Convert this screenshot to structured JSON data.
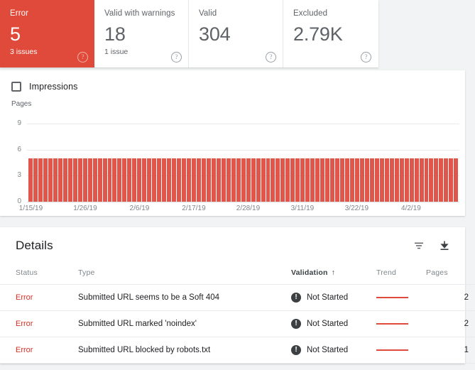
{
  "summary_cards": [
    {
      "label": "Error",
      "value": "5",
      "sub": "3 issues",
      "help": "?",
      "state": "error"
    },
    {
      "label": "Valid with warnings",
      "value": "18",
      "sub": "1 issue",
      "help": "?",
      "state": "warning"
    },
    {
      "label": "Valid",
      "value": "304",
      "sub": "",
      "help": "?",
      "state": "valid"
    },
    {
      "label": "Excluded",
      "value": "2.79K",
      "sub": "",
      "help": "?",
      "state": "excluded"
    }
  ],
  "chart_panel": {
    "legend": {
      "label": "Impressions",
      "checked": false,
      "checkbox_icon": "checkbox-unchecked-icon"
    }
  },
  "chart_data": {
    "type": "bar",
    "title": "",
    "ylabel": "Pages",
    "xlabel": "",
    "ylim": [
      0,
      9
    ],
    "yticks": [
      0,
      3,
      6,
      9
    ],
    "grid": true,
    "legend_position": "top-left",
    "bar_color": "#e0564a",
    "categories": [
      "1/15/19",
      "1/16/19",
      "1/17/19",
      "1/18/19",
      "1/19/19",
      "1/20/19",
      "1/21/19",
      "1/22/19",
      "1/23/19",
      "1/24/19",
      "1/25/19",
      "1/26/19",
      "1/27/19",
      "1/28/19",
      "1/29/19",
      "1/30/19",
      "1/31/19",
      "2/1/19",
      "2/2/19",
      "2/3/19",
      "2/4/19",
      "2/5/19",
      "2/6/19",
      "2/7/19",
      "2/8/19",
      "2/9/19",
      "2/10/19",
      "2/11/19",
      "2/12/19",
      "2/13/19",
      "2/14/19",
      "2/15/19",
      "2/16/19",
      "2/17/19",
      "2/18/19",
      "2/19/19",
      "2/20/19",
      "2/21/19",
      "2/22/19",
      "2/23/19",
      "2/24/19",
      "2/25/19",
      "2/26/19",
      "2/27/19",
      "2/28/19",
      "3/1/19",
      "3/2/19",
      "3/3/19",
      "3/4/19",
      "3/5/19",
      "3/6/19",
      "3/7/19",
      "3/8/19",
      "3/9/19",
      "3/10/19",
      "3/11/19",
      "3/12/19",
      "3/13/19",
      "3/14/19",
      "3/15/19",
      "3/16/19",
      "3/17/19",
      "3/18/19",
      "3/19/19",
      "3/20/19",
      "3/21/19",
      "3/22/19",
      "3/23/19",
      "3/24/19",
      "3/25/19",
      "3/26/19",
      "3/27/19",
      "3/28/19",
      "3/29/19",
      "3/30/19",
      "3/31/19",
      "4/1/19",
      "4/2/19",
      "4/3/19",
      "4/4/19",
      "4/5/19",
      "4/6/19",
      "4/7/19",
      "4/8/19",
      "4/9/19",
      "4/10/19",
      "4/11/19"
    ],
    "values": [
      5,
      5,
      5,
      5,
      5,
      5,
      5,
      5,
      5,
      5,
      5,
      5,
      5,
      5,
      5,
      5,
      5,
      5,
      5,
      5,
      5,
      5,
      5,
      5,
      5,
      5,
      5,
      5,
      5,
      5,
      5,
      5,
      5,
      5,
      5,
      5,
      5,
      5,
      5,
      5,
      5,
      5,
      5,
      5,
      5,
      5,
      5,
      5,
      5,
      5,
      5,
      5,
      5,
      5,
      5,
      5,
      5,
      5,
      5,
      5,
      5,
      5,
      5,
      5,
      5,
      5,
      5,
      5,
      5,
      5,
      5,
      5,
      5,
      5,
      5,
      5,
      5,
      5,
      5,
      5,
      5,
      5,
      5,
      5,
      5,
      5,
      5
    ],
    "xtick_labels": [
      "1/15/19",
      "1/26/19",
      "2/6/19",
      "2/17/19",
      "2/28/19",
      "3/11/19",
      "3/22/19",
      "4/2/19"
    ],
    "series": [
      {
        "name": "Pages",
        "values": [
          5
        ]
      }
    ]
  },
  "details": {
    "title": "Details",
    "filter_icon": "filter-icon",
    "download_icon": "download-icon",
    "columns": [
      {
        "key": "status",
        "label": "Status",
        "sorted": false
      },
      {
        "key": "type",
        "label": "Type",
        "sorted": false
      },
      {
        "key": "validation",
        "label": "Validation",
        "sorted": true,
        "sort_indicator": "↑"
      },
      {
        "key": "trend",
        "label": "Trend",
        "sorted": false
      },
      {
        "key": "pages",
        "label": "Pages",
        "sorted": false
      }
    ],
    "rows": [
      {
        "status": "Error",
        "type": "Submitted URL seems to be a Soft 404",
        "validation": "Not Started",
        "validation_icon": "exclamation-icon",
        "pages": "2"
      },
      {
        "status": "Error",
        "type": "Submitted URL marked 'noindex'",
        "validation": "Not Started",
        "validation_icon": "exclamation-icon",
        "pages": "2"
      },
      {
        "status": "Error",
        "type": "Submitted URL blocked by robots.txt",
        "validation": "Not Started",
        "validation_icon": "exclamation-icon",
        "pages": "1"
      }
    ]
  },
  "colors": {
    "error_red": "#e04a3a",
    "bar_red": "#e0564a",
    "status_red": "#d93025",
    "page_background": "#f1f3f4",
    "card_background": "#ffffff"
  }
}
